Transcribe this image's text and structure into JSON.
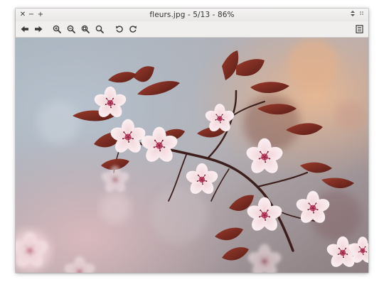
{
  "window": {
    "title": "fleurs.jpg - 5/13 - 86%",
    "controls": [
      "close",
      "minimize",
      "maximize"
    ]
  },
  "toolbar": {
    "buttons": [
      {
        "name": "previous-image",
        "icon": "arrow-left-icon"
      },
      {
        "name": "next-image",
        "icon": "arrow-right-icon"
      },
      {
        "name": "zoom-in",
        "icon": "zoom-in-icon"
      },
      {
        "name": "zoom-out",
        "icon": "zoom-out-icon"
      },
      {
        "name": "zoom-fit",
        "icon": "zoom-fit-icon"
      },
      {
        "name": "zoom-original",
        "icon": "zoom-original-icon"
      },
      {
        "name": "rotate-left",
        "icon": "rotate-ccw-icon"
      },
      {
        "name": "rotate-right",
        "icon": "rotate-cw-icon"
      },
      {
        "name": "menu",
        "icon": "document-menu-icon"
      }
    ]
  },
  "image": {
    "subject": "cherry-blossom-photo"
  },
  "colors": {
    "titlebar_text": "#333333",
    "icon": "#3b3b3b",
    "window_bg": "#f0efee"
  }
}
